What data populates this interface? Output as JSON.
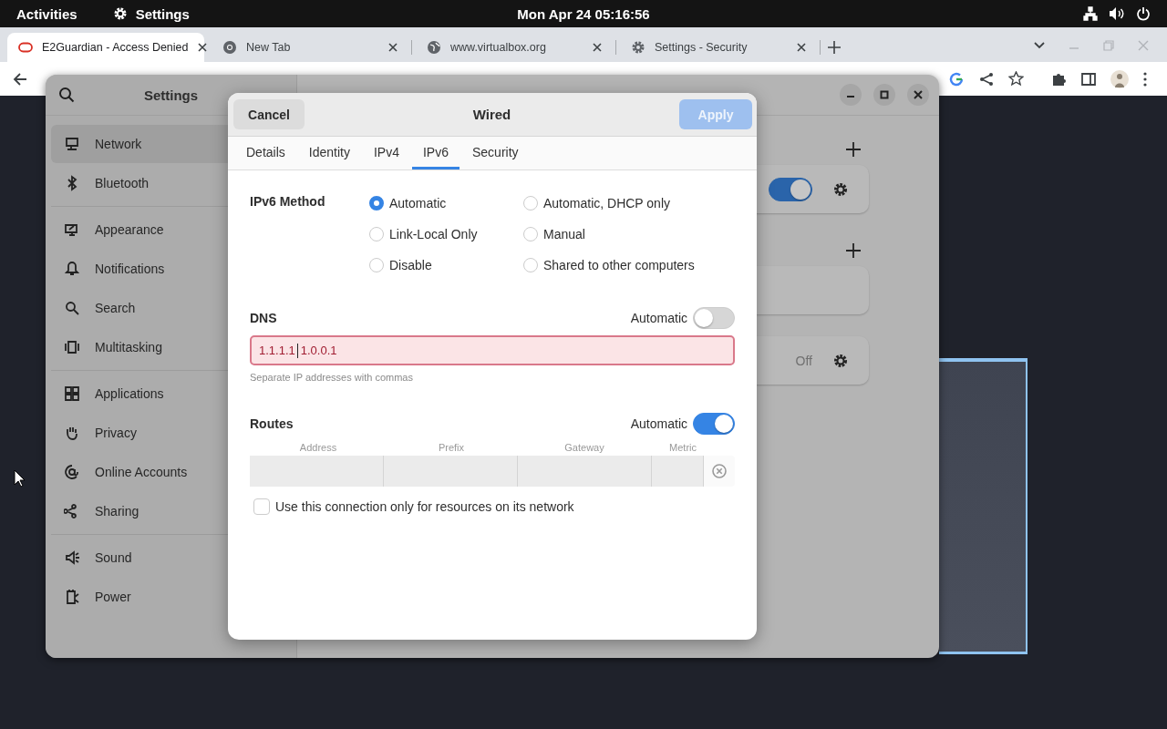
{
  "top_bar": {
    "activities": "Activities",
    "app": "Settings",
    "clock": "Mon Apr 24  05:16:56"
  },
  "browser": {
    "tabs": [
      {
        "title": "E2Guardian - Access Denied",
        "selected": true
      },
      {
        "title": "New Tab",
        "selected": false
      },
      {
        "title": "www.virtualbox.org",
        "selected": false
      },
      {
        "title": "Settings - Security",
        "selected": false
      }
    ]
  },
  "settings": {
    "title": "Settings",
    "sidebar": {
      "groups": [
        [
          {
            "label": "Network",
            "selected": true
          },
          {
            "label": "Bluetooth",
            "selected": false
          }
        ],
        [
          {
            "label": "Appearance",
            "selected": false
          },
          {
            "label": "Notifications",
            "selected": false
          },
          {
            "label": "Search",
            "selected": false
          },
          {
            "label": "Multitasking",
            "selected": false
          }
        ],
        [
          {
            "label": "Applications",
            "selected": false
          },
          {
            "label": "Privacy",
            "selected": false
          },
          {
            "label": "Online Accounts",
            "selected": false
          },
          {
            "label": "Sharing",
            "selected": false
          }
        ],
        [
          {
            "label": "Sound",
            "selected": false
          },
          {
            "label": "Power",
            "selected": false
          }
        ]
      ]
    },
    "network_cards": [
      {
        "kind": "toggle",
        "on": true
      },
      {
        "kind": "empty"
      },
      {
        "kind": "status",
        "status": "Off"
      }
    ]
  },
  "dialog": {
    "title": "Wired",
    "cancel": "Cancel",
    "apply": "Apply",
    "apply_disabled": true,
    "tabs": [
      {
        "label": "Details",
        "selected": false
      },
      {
        "label": "Identity",
        "selected": false
      },
      {
        "label": "IPv4",
        "selected": false
      },
      {
        "label": "IPv6",
        "selected": true
      },
      {
        "label": "Security",
        "selected": false
      }
    ],
    "method_label": "IPv6 Method",
    "methods": [
      {
        "label": "Automatic",
        "selected": true
      },
      {
        "label": "Automatic, DHCP only",
        "selected": false
      },
      {
        "label": "Link-Local Only",
        "selected": false
      },
      {
        "label": "Manual",
        "selected": false
      },
      {
        "label": "Disable",
        "selected": false
      },
      {
        "label": "Shared to other computers",
        "selected": false
      }
    ],
    "dns": {
      "label": "DNS",
      "auto_label": "Automatic",
      "automatic": false,
      "value_before_cursor": "1.1.1.1",
      "value_after_cursor": "1.0.0.1",
      "invalid": true,
      "hint": "Separate IP addresses with commas"
    },
    "routes": {
      "label": "Routes",
      "auto_label": "Automatic",
      "automatic": true,
      "columns": [
        "Address",
        "Prefix",
        "Gateway",
        "Metric"
      ]
    },
    "only_local": {
      "label": "Use this connection only for resources on its network",
      "checked": false
    }
  }
}
